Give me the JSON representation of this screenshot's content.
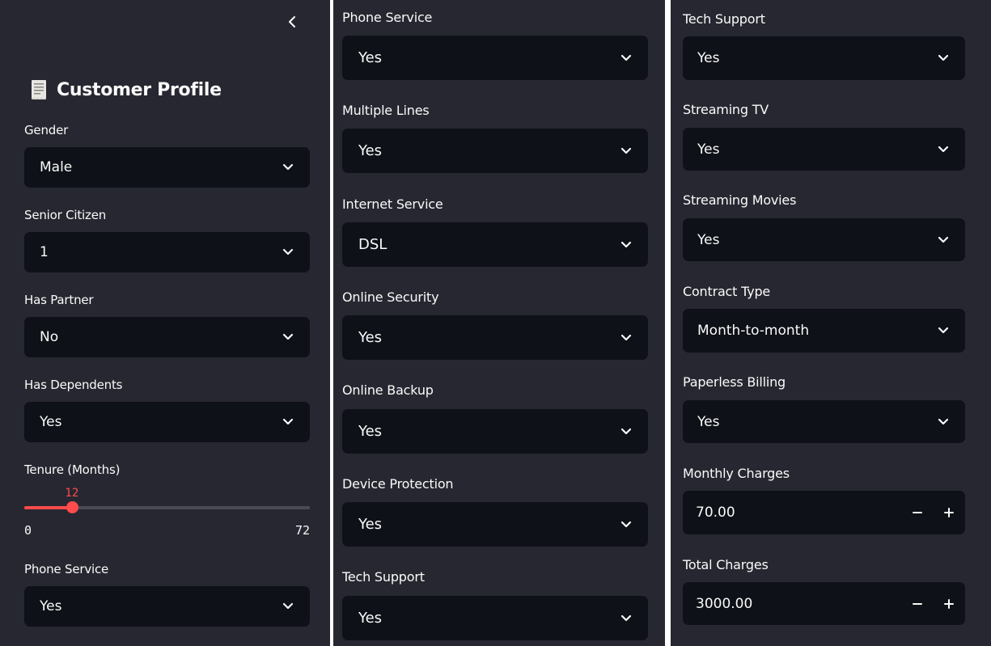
{
  "colors": {
    "panel_bg": "#272731",
    "input_bg": "#0e1117",
    "accent": "#ff4b4b",
    "text": "#fafafa"
  },
  "sidebar": {
    "collapse_icon": "chevron-left-icon",
    "title_icon": "receipt-icon",
    "title": "Customer Profile",
    "gender": {
      "label": "Gender",
      "value": "Male"
    },
    "senior_citizen": {
      "label": "Senior Citizen",
      "value": "1"
    },
    "has_partner": {
      "label": "Has Partner",
      "value": "No"
    },
    "has_dependents": {
      "label": "Has Dependents",
      "value": "Yes"
    },
    "tenure": {
      "label": "Tenure (Months)",
      "value": 12,
      "value_text": "12",
      "min": "0",
      "max": "72",
      "min_value": 0,
      "max_value": 72
    },
    "phone_service": {
      "label": "Phone Service",
      "value": "Yes"
    }
  },
  "middle": {
    "phone_service": {
      "label": "Phone Service",
      "value": "Yes"
    },
    "multiple_lines": {
      "label": "Multiple Lines",
      "value": "Yes"
    },
    "internet_service": {
      "label": "Internet Service",
      "value": "DSL"
    },
    "online_security": {
      "label": "Online Security",
      "value": "Yes"
    },
    "online_backup": {
      "label": "Online Backup",
      "value": "Yes"
    },
    "device_protection": {
      "label": "Device Protection",
      "value": "Yes"
    },
    "tech_support": {
      "label": "Tech Support",
      "value": "Yes"
    }
  },
  "right": {
    "tech_support": {
      "label": "Tech Support",
      "value": "Yes"
    },
    "streaming_tv": {
      "label": "Streaming TV",
      "value": "Yes"
    },
    "streaming_movies": {
      "label": "Streaming Movies",
      "value": "Yes"
    },
    "contract_type": {
      "label": "Contract Type",
      "value": "Month-to-month"
    },
    "paperless_billing": {
      "label": "Paperless Billing",
      "value": "Yes"
    },
    "monthly_charges": {
      "label": "Monthly Charges",
      "value": "70.00",
      "minus": "−",
      "plus": "+"
    },
    "total_charges": {
      "label": "Total Charges",
      "value": "3000.00",
      "minus": "−",
      "plus": "+"
    }
  }
}
